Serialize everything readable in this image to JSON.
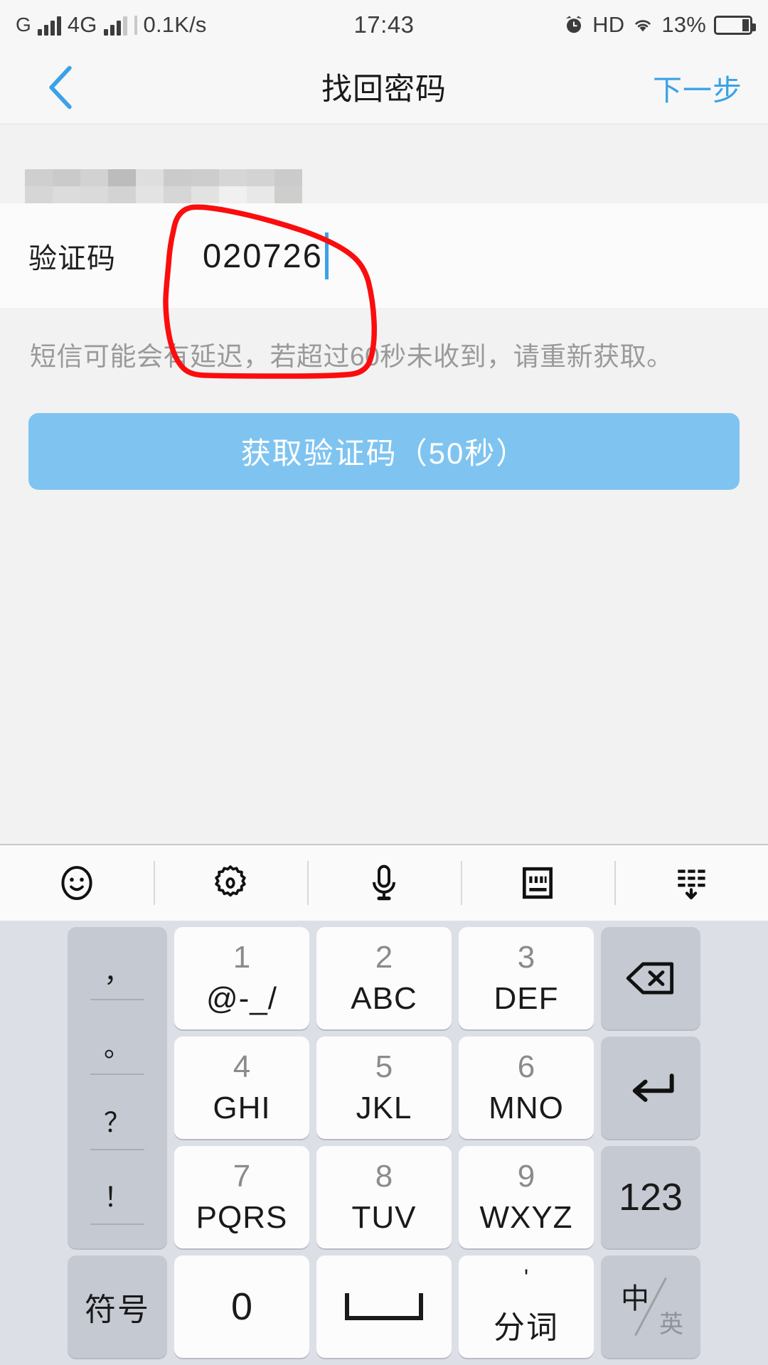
{
  "status_bar": {
    "carrier_letter": "G",
    "network_type": "4G",
    "data_rate": "0.1K/s",
    "time": "17:43",
    "hd_label": "HD",
    "battery_percent": "13%",
    "icons": {
      "signal": "signal-bars-icon",
      "signal2": "signal-bars-4g-icon",
      "alarm": "alarm-clock-icon",
      "wifi": "wifi-icon",
      "battery": "battery-icon"
    }
  },
  "nav_bar": {
    "back_icon": "chevron-left-icon",
    "title": "找回密码",
    "next_label": "下一步",
    "accent_color": "#3aa2e8"
  },
  "form": {
    "masked_field_note": "masked-phone-number",
    "code_label": "验证码",
    "code_value": "020726",
    "hint": "短信可能会有延迟，若超过60秒未收到，请重新获取。",
    "get_code_button": "获取验证码（50秒）",
    "button_color": "#7fc4f0"
  },
  "annotation": {
    "shape": "hand-drawn-red-circle",
    "color": "#fb0d0d"
  },
  "keyboard": {
    "toolbar": [
      {
        "name": "emoji-icon",
        "label": "emoji"
      },
      {
        "name": "gear-icon",
        "label": "settings"
      },
      {
        "name": "microphone-icon",
        "label": "voice"
      },
      {
        "name": "keyboard-icon",
        "label": "keyboard"
      },
      {
        "name": "hide-keyboard-icon",
        "label": "hide"
      }
    ],
    "punct_key": {
      "name": "punctuation-key",
      "chars": [
        "，",
        "。",
        "？",
        "！"
      ]
    },
    "keys": [
      {
        "name": "key-1",
        "num": "1",
        "alpha": "@-_/",
        "style": "white"
      },
      {
        "name": "key-2",
        "num": "2",
        "alpha": "ABC",
        "style": "white"
      },
      {
        "name": "key-3",
        "num": "3",
        "alpha": "DEF",
        "style": "white"
      },
      {
        "name": "key-backspace",
        "icon": "backspace-icon",
        "style": "grey"
      },
      {
        "name": "key-4",
        "num": "4",
        "alpha": "GHI",
        "style": "white"
      },
      {
        "name": "key-5",
        "num": "5",
        "alpha": "JKL",
        "style": "white"
      },
      {
        "name": "key-6",
        "num": "6",
        "alpha": "MNO",
        "style": "white"
      },
      {
        "name": "key-enter",
        "icon": "enter-icon",
        "style": "grey"
      },
      {
        "name": "key-7",
        "num": "7",
        "alpha": "PQRS",
        "style": "white"
      },
      {
        "name": "key-8",
        "num": "8",
        "alpha": "TUV",
        "style": "white"
      },
      {
        "name": "key-9",
        "num": "9",
        "alpha": "WXYZ",
        "style": "white"
      },
      {
        "name": "key-123",
        "text": "123",
        "style": "grey"
      }
    ],
    "bottom_row": {
      "symbols": "符号",
      "zero": "0",
      "space": "space-bar-icon",
      "fenci_apos": "'",
      "fenci": "分词",
      "lang_zh": "中",
      "lang_en": "英"
    }
  }
}
